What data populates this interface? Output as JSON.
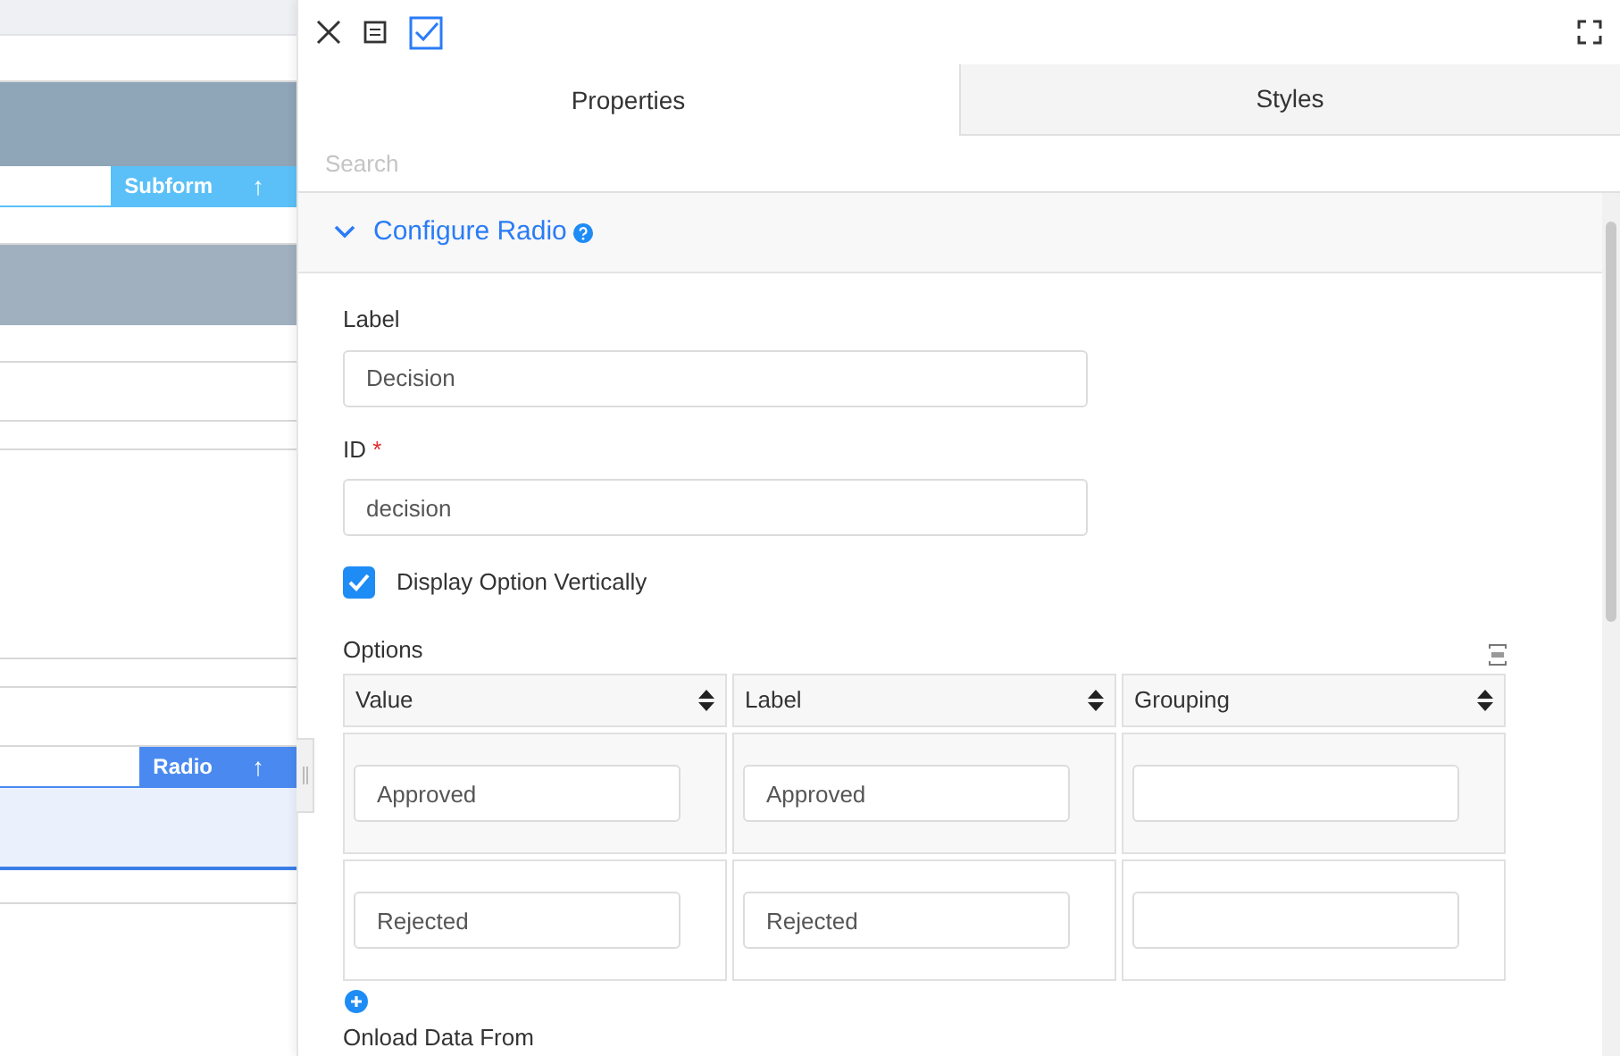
{
  "canvas": {
    "subform_tag": {
      "label": "Subform",
      "icon": "↑"
    },
    "radio_tag": {
      "label": "Radio",
      "icon": "↑"
    }
  },
  "panel": {
    "tabs": [
      {
        "label": "Properties",
        "selected": true
      },
      {
        "label": "Styles",
        "selected": false
      }
    ],
    "search": {
      "placeholder": "Search"
    },
    "section": {
      "title": "Configure Radio",
      "expanded": true
    },
    "fields": [
      {
        "label": "Label",
        "value": "Decision"
      },
      {
        "label": "ID",
        "required_mark": "*",
        "value": "decision"
      }
    ],
    "display_vertically": {
      "label": "Display Option Vertically",
      "checked": true
    },
    "options": {
      "title": "Options",
      "columns": [
        "Value",
        "Label",
        "Grouping"
      ],
      "rows": [
        [
          "Approved",
          "Approved",
          ""
        ],
        [
          "Rejected",
          "Rejected",
          ""
        ]
      ]
    },
    "next_section_label": "Onload Data From"
  }
}
